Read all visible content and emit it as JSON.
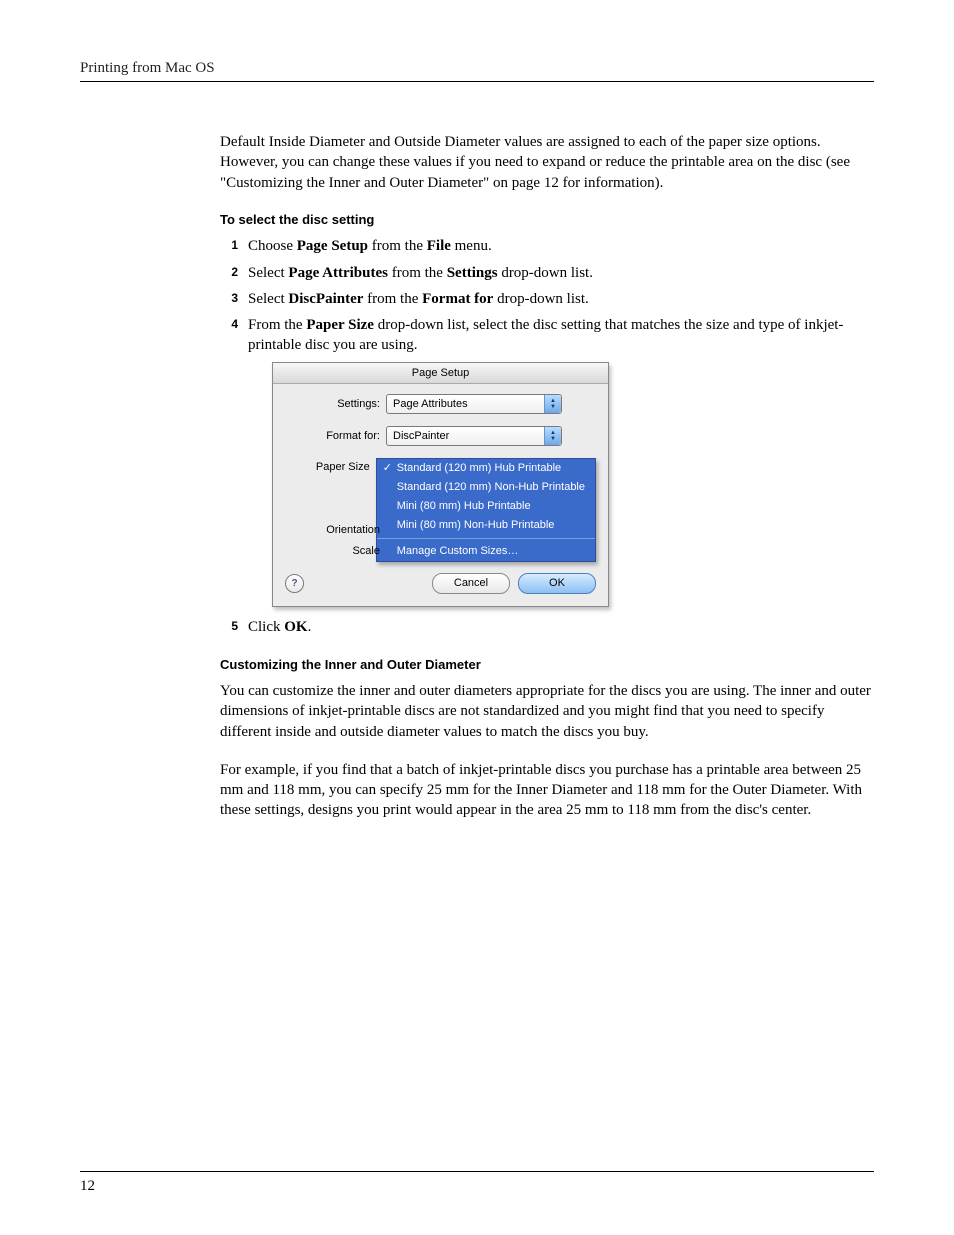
{
  "header": {
    "title": "Printing from Mac OS"
  },
  "intro": {
    "para": "Default Inside Diameter and Outside Diameter values are assigned to each of the paper size options. However, you can change these values if you need to expand or reduce the printable area on the disc (see \"Customizing the Inner and Outer Diameter\" on page 12 for information)."
  },
  "section1": {
    "heading": "To select the disc setting",
    "steps": {
      "s1_a": "Choose ",
      "s1_b": "Page Setup",
      "s1_c": " from the ",
      "s1_d": "File",
      "s1_e": " menu.",
      "s2_a": "Select ",
      "s2_b": "Page Attributes",
      "s2_c": " from the ",
      "s2_d": "Settings",
      "s2_e": " drop-down list.",
      "s3_a": "Select ",
      "s3_b": "DiscPainter",
      "s3_c": " from the ",
      "s3_d": "Format for",
      "s3_e": " drop-down list.",
      "s4_a": "From the ",
      "s4_b": "Paper Size",
      "s4_c": " drop-down list, select the disc setting that matches the size and type of inkjet-printable disc you are using.",
      "s5_a": "Click ",
      "s5_b": "OK",
      "s5_c": "."
    }
  },
  "dialog": {
    "title": "Page Setup",
    "labels": {
      "settings": "Settings:",
      "format_for": "Format for:",
      "paper_size": "Paper Size",
      "orientation": "Orientation",
      "scale": "Scale"
    },
    "settings_value": "Page Attributes",
    "format_for_value": "DiscPainter",
    "paper_size_menu": {
      "selected": "Standard (120 mm) Hub Printable",
      "items": [
        "Standard (120 mm) Hub Printable",
        "Standard (120 mm) Non-Hub Printable",
        "Mini (80 mm) Hub Printable",
        "Mini (80 mm) Non-Hub Printable"
      ],
      "manage": "Manage Custom Sizes…"
    },
    "help": "?",
    "buttons": {
      "cancel": "Cancel",
      "ok": "OK"
    }
  },
  "section2": {
    "heading": "Customizing the Inner and Outer Diameter",
    "para1": "You can customize the inner and outer diameters appropriate for the discs you are using. The inner and outer dimensions of inkjet-printable discs are not standardized and you might find that you need to specify different inside and outside diameter values to match the discs you buy.",
    "para2": "For example, if you find that a batch of inkjet-printable discs you purchase has a printable area between 25 mm and 118 mm, you can specify 25 mm for the Inner Diameter and 118 mm for the Outer Diameter. With these settings, designs you print would appear in the area 25 mm to 118 mm from the disc's center."
  },
  "footer": {
    "page_number": "12"
  }
}
